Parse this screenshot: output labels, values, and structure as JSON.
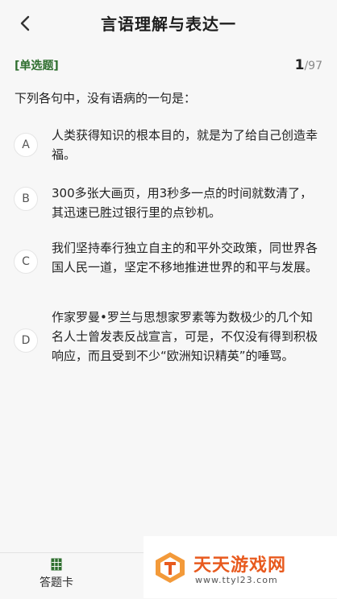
{
  "header": {
    "back_icon": "chevron-left-icon",
    "title": "言语理解与表达一"
  },
  "question": {
    "type_label": "[单选题]",
    "current": "1",
    "total": "/97",
    "stem": "下列各句中，没有语病的一句是：",
    "options": [
      {
        "letter": "A",
        "text": "人类获得知识的根本目的，就是为了给自己创造幸福。"
      },
      {
        "letter": "B",
        "text": "300多张大画页，用3秒多一点的时间就数清了，其迅速已胜过银行里的点钞机。"
      },
      {
        "letter": "C",
        "text": "我们坚持奉行独立自主的和平外交政策，同世界各国人民一道，坚定不移地推进世界的和平与发展。"
      },
      {
        "letter": "D",
        "text": "作家罗曼•罗兰与思想家罗素等为数极少的几个知名人士曾发表反战宣言，可是，不仅没有得到积极响应，而且受到不少“欧洲知识精英”的唾骂。"
      }
    ]
  },
  "footer": {
    "answer_card_icon": "grid-icon",
    "answer_card_label": "答题卡"
  },
  "watermark": {
    "name": "天天游戏网",
    "url": "www.ttyl23.com"
  },
  "colors": {
    "accent_green": "#2e6e2e",
    "background": "#f7f7f7",
    "watermark_orange": "#e85a1e"
  }
}
